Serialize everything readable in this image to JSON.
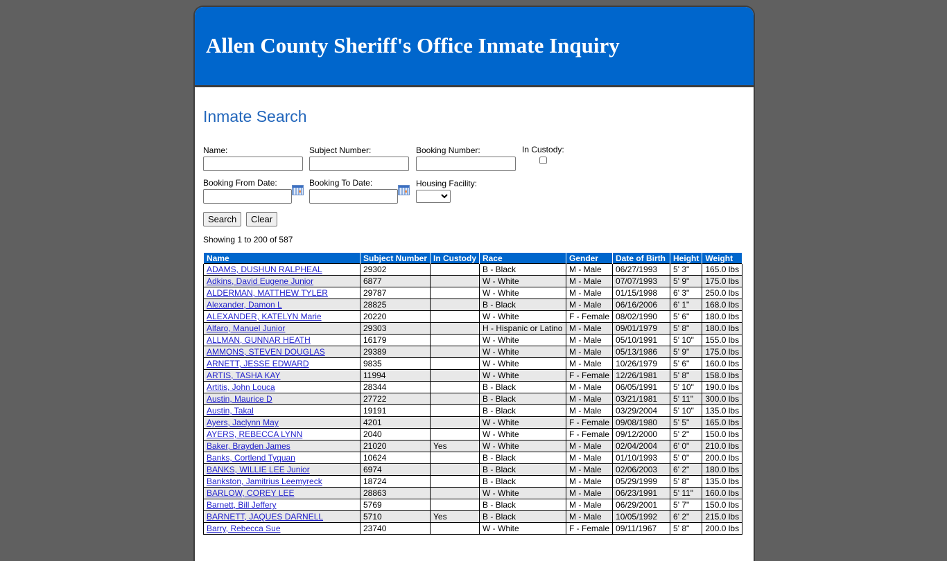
{
  "header": {
    "title": "Allen County Sheriff's Office Inmate Inquiry"
  },
  "page_title": "Inmate Search",
  "form": {
    "name_label": "Name:",
    "name_value": "",
    "subject_label": "Subject Number:",
    "subject_value": "",
    "booking_label": "Booking Number:",
    "booking_value": "",
    "custody_label": "In Custody:",
    "from_label": "Booking From Date:",
    "from_value": "",
    "to_label": "Booking To Date:",
    "to_value": "",
    "facility_label": "Housing Facility:",
    "facility_value": "",
    "search_label": "Search",
    "clear_label": "Clear"
  },
  "showing": "Showing 1 to 200 of 587",
  "table": {
    "columns": [
      "Name",
      "Subject Number",
      "In Custody",
      "Race",
      "Gender",
      "Date of Birth",
      "Height",
      "Weight"
    ],
    "rows": [
      [
        "ADAMS, DUSHUN RALPHEAL",
        "29302",
        "",
        "B - Black",
        "M - Male",
        "06/27/1993",
        "5' 3\"",
        "165.0 lbs"
      ],
      [
        "Adkins, David Eugene Junior",
        "6877",
        "",
        "W - White",
        "M - Male",
        "07/07/1993",
        "5' 9\"",
        "175.0 lbs"
      ],
      [
        "ALDERMAN, MATTHEW TYLER",
        "29787",
        "",
        "W - White",
        "M - Male",
        "01/15/1998",
        "6' 3\"",
        "250.0 lbs"
      ],
      [
        "Alexander, Damon L",
        "28825",
        "",
        "B - Black",
        "M - Male",
        "06/16/2006",
        "6' 1\"",
        "168.0 lbs"
      ],
      [
        "ALEXANDER, KATELYN Marie",
        "20220",
        "",
        "W - White",
        "F - Female",
        "08/02/1990",
        "5' 6\"",
        "180.0 lbs"
      ],
      [
        "Alfaro, Manuel Junior",
        "29303",
        "",
        "H - Hispanic or Latino",
        "M - Male",
        "09/01/1979",
        "5' 8\"",
        "180.0 lbs"
      ],
      [
        "ALLMAN, GUNNAR HEATH",
        "16179",
        "",
        "W - White",
        "M - Male",
        "05/10/1991",
        "5' 10\"",
        "155.0 lbs"
      ],
      [
        "AMMONS, STEVEN DOUGLAS",
        "29389",
        "",
        "W - White",
        "M - Male",
        "05/13/1986",
        "5' 9\"",
        "175.0 lbs"
      ],
      [
        "ARNETT, JESSE EDWARD",
        "9835",
        "",
        "W - White",
        "M - Male",
        "10/26/1979",
        "5' 6\"",
        "160.0 lbs"
      ],
      [
        "ARTIS, TASHA KAY",
        "11994",
        "",
        "W - White",
        "F - Female",
        "12/26/1981",
        "5' 8\"",
        "158.0 lbs"
      ],
      [
        "Artitis, John Louca",
        "28344",
        "",
        "B - Black",
        "M - Male",
        "06/05/1991",
        "5' 10\"",
        "190.0 lbs"
      ],
      [
        "Austin, Maurice D",
        "27722",
        "",
        "B - Black",
        "M - Male",
        "03/21/1981",
        "5' 11\"",
        "300.0 lbs"
      ],
      [
        "Austin, Takal",
        "19191",
        "",
        "B - Black",
        "M - Male",
        "03/29/2004",
        "5' 10\"",
        "135.0 lbs"
      ],
      [
        "Ayers, Jaclynn May",
        "4201",
        "",
        "W - White",
        "F - Female",
        "09/08/1980",
        "5' 5\"",
        "165.0 lbs"
      ],
      [
        "AYERS, REBECCA LYNN",
        "2040",
        "",
        "W - White",
        "F - Female",
        "09/12/2000",
        "5' 2\"",
        "150.0 lbs"
      ],
      [
        "Baker, Brayden James",
        "21020",
        "Yes",
        "W - White",
        "M - Male",
        "02/04/2004",
        "6' 0\"",
        "210.0 lbs"
      ],
      [
        "Banks, Cortlend Tyquan",
        "10624",
        "",
        "B - Black",
        "M - Male",
        "01/10/1993",
        "5' 0\"",
        "200.0 lbs"
      ],
      [
        "BANKS, WILLIE LEE Junior",
        "6974",
        "",
        "B - Black",
        "M - Male",
        "02/06/2003",
        "6' 2\"",
        "180.0 lbs"
      ],
      [
        "Bankston, Jamitrius Leemyreck",
        "18724",
        "",
        "B - Black",
        "M - Male",
        "05/29/1999",
        "5' 8\"",
        "135.0 lbs"
      ],
      [
        "BARLOW, COREY LEE",
        "28863",
        "",
        "W - White",
        "M - Male",
        "06/23/1991",
        "5' 11\"",
        "160.0 lbs"
      ],
      [
        "Barnett, Bill Jeffery",
        "5769",
        "",
        "B - Black",
        "M - Male",
        "06/29/2001",
        "5' 7\"",
        "150.0 lbs"
      ],
      [
        "BARNETT, JAQUES DARNELL",
        "5710",
        "Yes",
        "B - Black",
        "M - Male",
        "10/05/1992",
        "6' 2\"",
        "215.0 lbs"
      ],
      [
        "Barry, Rebecca Sue",
        "23740",
        "",
        "W - White",
        "F - Female",
        "09/11/1967",
        "5' 8\"",
        "200.0 lbs"
      ]
    ]
  }
}
